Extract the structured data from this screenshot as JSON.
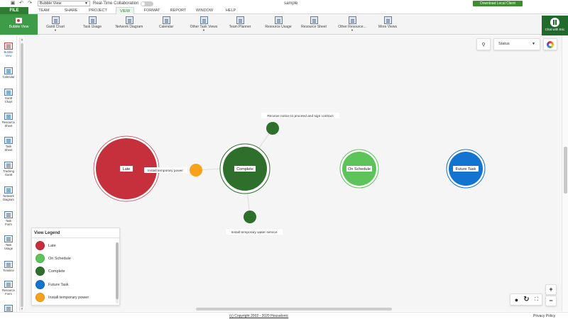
{
  "titlebar": {
    "view_selector": "Bubble View",
    "realtime_label": "Real-Time Collaboration",
    "document_title": "sample",
    "download_label": "Download Local Client"
  },
  "menu": {
    "file": "FILE",
    "tabs": [
      "TEAM",
      "SHARE",
      "PROJECT",
      "VIEW",
      "FORMAT",
      "REPORT",
      "WINDOW",
      "HELP"
    ],
    "active_tab": "VIEW"
  },
  "ribbon": {
    "bubble_view": "Bubble View",
    "buttons": [
      {
        "label": "Gantt Chart",
        "dropdown": true
      },
      {
        "label": "Task Usage",
        "dropdown": false
      },
      {
        "label": "Network Diagram",
        "dropdown": false
      },
      {
        "label": "Calendar",
        "dropdown": false
      },
      {
        "label": "Other Task Views",
        "dropdown": true
      },
      {
        "label": "Team Planner",
        "dropdown": false
      },
      {
        "label": "Resource Usage",
        "dropdown": false
      },
      {
        "label": "Resource Sheet",
        "dropdown": false
      },
      {
        "label": "Other Resource...",
        "dropdown": true
      },
      {
        "label": "More Views",
        "dropdown": false
      }
    ],
    "chat_label": "Chat with Eric"
  },
  "sidebar": {
    "items": [
      {
        "line1": "Bubble",
        "line2": "View",
        "active": true
      },
      {
        "line1": "Calendar",
        "line2": "",
        "active": false
      },
      {
        "line1": "Gantt",
        "line2": "Chart",
        "active": false
      },
      {
        "line1": "Resource",
        "line2": "Sheet",
        "active": false
      },
      {
        "line1": "Task",
        "line2": "Sheet",
        "active": false
      },
      {
        "line1": "Tracking",
        "line2": "Gantt",
        "active": false
      },
      {
        "line1": "Network",
        "line2": "Diagram",
        "active": false
      },
      {
        "line1": "Task",
        "line2": "Form",
        "active": false
      },
      {
        "line1": "Task",
        "line2": "Usage",
        "active": false
      },
      {
        "line1": "Timeline",
        "line2": "",
        "active": false
      },
      {
        "line1": "Resource",
        "line2": "Form",
        "active": false
      }
    ]
  },
  "toolbar": {
    "status_select": "Status"
  },
  "bubbles": {
    "colors": {
      "late": "#c62f3c",
      "on_schedule": "#5cc45a",
      "complete": "#2e6f2c",
      "future": "#1273d0",
      "install_power": "#f7a21a"
    },
    "labels": {
      "late": "Late",
      "complete": "Complete",
      "on_schedule": "On Schedule",
      "future": "Future Task",
      "install_power": "Install temporary power",
      "receive_notice": "Receive notice to proceed and sign contract",
      "install_water": "Install temporary water service"
    }
  },
  "legend": {
    "title": "View Legend",
    "items": [
      {
        "label": "Late",
        "color": "#c62f3c"
      },
      {
        "label": "On Schedule",
        "color": "#5cc45a"
      },
      {
        "label": "Complete",
        "color": "#2e6f2c"
      },
      {
        "label": "Future Task",
        "color": "#1273d0"
      },
      {
        "label": "Install temporary power",
        "color": "#f7a21a"
      }
    ]
  },
  "footer": {
    "copyright": "(c) Copyright 2002 - 2020 Housatonic",
    "privacy": "Privacy Policy"
  }
}
